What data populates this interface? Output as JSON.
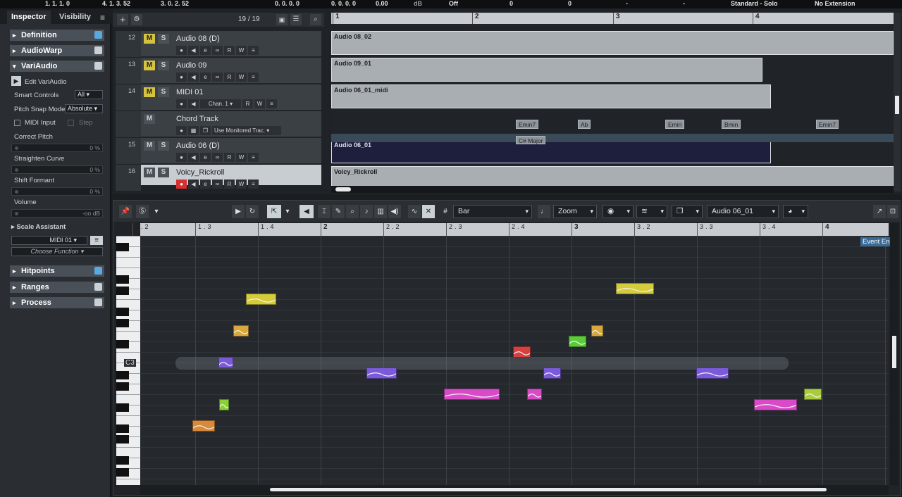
{
  "transport": {
    "pos1": "1. 1. 1.   0",
    "pos2": "4. 1. 3. 52",
    "pos3": "3. 0. 2. 52",
    "pos4": "0. 0. 0.   0",
    "pos5": "0. 0. 0.   0",
    "db_val": "0.00",
    "db_unit": "dB",
    "off": "Off",
    "v1": "0",
    "v2": "0",
    "v3": "-",
    "v4": "-",
    "mode": "Standard - Solo",
    "ext": "No Extension"
  },
  "inspector": {
    "tab_inspector": "Inspector",
    "tab_visibility": "Visibility",
    "sections": {
      "definition": "Definition",
      "audiowarp": "AudioWarp",
      "variaudio": "VariAudio",
      "hitpoints": "Hitpoints",
      "ranges": "Ranges",
      "process": "Process"
    },
    "edit_variaudio": "Edit VariAudio",
    "smart_controls_label": "Smart Controls",
    "smart_controls_value": "All",
    "pitch_snap_label": "Pitch Snap Mode",
    "pitch_snap_value": "Absolute",
    "midi_input": "MIDI Input",
    "step": "Step",
    "correct_pitch": "Correct Pitch",
    "correct_pitch_val": "0 %",
    "straighten_curve": "Straighten Curve",
    "straighten_curve_val": "0 %",
    "shift_formant": "Shift Formant",
    "shift_formant_val": "0 %",
    "volume": "Volume",
    "volume_val": "-oo dB",
    "scale_assistant": "Scale Assistant",
    "scale_source": "MIDI 01",
    "choose_function": "Choose Function"
  },
  "project": {
    "track_count": "19 / 19",
    "tracks": [
      {
        "num": "12",
        "name": "Audio 08 (D)",
        "mute": "M",
        "solo": "S"
      },
      {
        "num": "13",
        "name": "Audio 09",
        "mute": "M",
        "solo": "S"
      },
      {
        "num": "14",
        "name": "MIDI 01",
        "mute": "M",
        "solo": "S",
        "chan": "Chan. 1"
      },
      {
        "num": "",
        "name": "Chord Track",
        "mute": "M",
        "monitor": "Use Monitored Trac."
      },
      {
        "num": "15",
        "name": "Audio 06 (D)",
        "mute": "M",
        "solo": "S"
      },
      {
        "num": "16",
        "name": "Voicy_Rickroll",
        "mute": "M",
        "solo": "S"
      }
    ],
    "bars": [
      "1",
      "2",
      "3",
      "4"
    ],
    "events": [
      "Audio 08_02",
      "Audio 09_01",
      "Audio 06_01_midi",
      "Audio 06_01",
      "Voicy_Rickroll"
    ],
    "chords": [
      "Emin7",
      "Ab",
      "Emin",
      "Bmin",
      "Emin7"
    ],
    "scale": "C# Major",
    "rw": {
      "r": "R",
      "w": "W"
    }
  },
  "editor": {
    "quant": "Bar",
    "zoom": "Zoom",
    "event": "Audio 06_01",
    "ruler": [
      "1.2",
      "1.3",
      "1.4",
      "2",
      "2.2",
      "2.3",
      "2.4",
      "3",
      "3.2",
      "3.3",
      "3.4",
      "4"
    ],
    "key_label": "C3",
    "event_end": "Event End",
    "notes": [
      {
        "color": "#d8893a",
        "cx": 1.27,
        "pitch": -6,
        "len": 0.09
      },
      {
        "color": "#8ad034",
        "cx": 1.35,
        "pitch": -4,
        "len": 0.035
      },
      {
        "color": "#7a5ad8",
        "cx": 1.36,
        "pitch": 0,
        "len": 0.06
      },
      {
        "color": "#d8a83a",
        "cx": 1.42,
        "pitch": 3,
        "len": 0.06
      },
      {
        "color": "#d4cc3a",
        "cx": 1.5,
        "pitch": 6,
        "len": 0.12
      },
      {
        "color": "#7a5ad8",
        "cx": 1.98,
        "pitch": -1,
        "len": 0.12
      },
      {
        "color": "#d84ac8",
        "cx": 2.34,
        "pitch": -3,
        "len": 0.22
      },
      {
        "color": "#d84040",
        "cx": 2.54,
        "pitch": 1,
        "len": 0.07
      },
      {
        "color": "#d84ac8",
        "cx": 2.59,
        "pitch": -3,
        "len": 0.06
      },
      {
        "color": "#7a5ad8",
        "cx": 2.66,
        "pitch": -1,
        "len": 0.07
      },
      {
        "color": "#5acc3a",
        "cx": 2.76,
        "pitch": 2,
        "len": 0.07
      },
      {
        "color": "#d8a83a",
        "cx": 2.84,
        "pitch": 3,
        "len": 0.05
      },
      {
        "color": "#d4cc3a",
        "cx": 2.99,
        "pitch": 7,
        "len": 0.15
      },
      {
        "color": "#7a5ad8",
        "cx": 3.3,
        "pitch": -1,
        "len": 0.13
      },
      {
        "color": "#d84ac8",
        "cx": 3.55,
        "pitch": -4,
        "len": 0.17
      },
      {
        "color": "#a8cc3a",
        "cx": 3.7,
        "pitch": -3,
        "len": 0.07
      }
    ]
  }
}
